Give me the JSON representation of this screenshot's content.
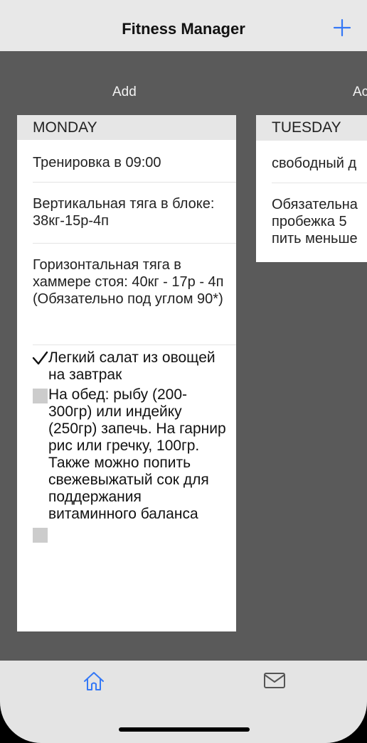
{
  "navbar": {
    "title": "Fitness Manager",
    "add_icon": "plus-icon",
    "accent_color": "#3478f6"
  },
  "columns": [
    {
      "add_label": "Add",
      "day": "MONDAY",
      "entries": [
        "Тренировка в 09:00",
        "Вертикальная тяга в блоке: 38кг-15р-4п",
        "Горизонтальная тяга в хаммере стоя: 40кг - 17р - 4п (Обязательно под углом 90*)"
      ],
      "checklist": [
        {
          "text": "Легкий салат из овощей на завтрак",
          "checked": true
        },
        {
          "text": "На обед: рыбу (200-300гр) или индейку (250гр) запечь. На гарнир рис или гречку, 100гр. Также можно попить свежевыжатый сок для поддержания витаминного баланса",
          "checked": false
        },
        {
          "text": "",
          "checked": false
        }
      ]
    },
    {
      "add_label": "Ac",
      "day": "TUESDAY",
      "entries": [
        "свободный д",
        "Обязательна пробежка 5 пить меньше"
      ]
    }
  ],
  "tabbar": {
    "items": [
      {
        "icon": "home-icon",
        "active": true,
        "color": "#3478f6"
      },
      {
        "icon": "mail-icon",
        "active": false,
        "color": "#555555"
      }
    ]
  }
}
